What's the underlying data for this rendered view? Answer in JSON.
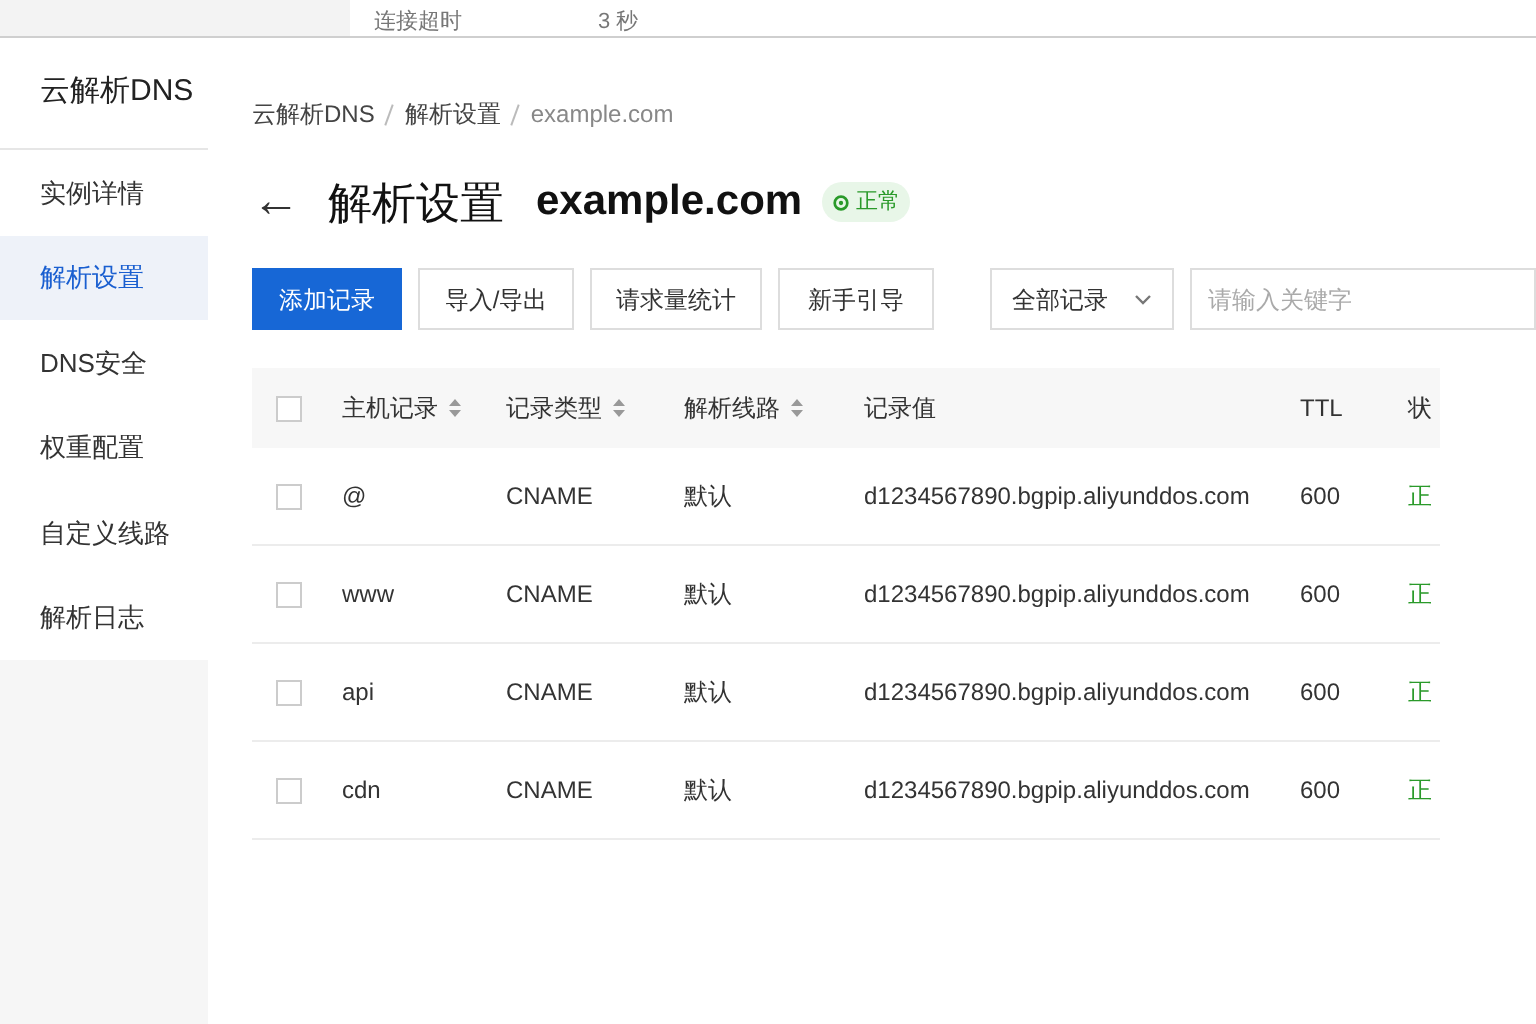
{
  "top_strip": {
    "label": "连接超时",
    "value": "3 秒"
  },
  "sidebar": {
    "title": "云解析DNS",
    "items": [
      {
        "label": "实例详情",
        "selected": false
      },
      {
        "label": "解析设置",
        "selected": true
      },
      {
        "label": "DNS安全",
        "selected": false
      },
      {
        "label": "权重配置",
        "selected": false
      },
      {
        "label": "自定义线路",
        "selected": false
      },
      {
        "label": "解析日志",
        "selected": false
      }
    ]
  },
  "breadcrumb": [
    "云解析DNS",
    "解析设置",
    "example.com"
  ],
  "page_title": {
    "back": "←",
    "title": "解析设置",
    "domain": "example.com",
    "status": "正常"
  },
  "toolbar": {
    "buttons": [
      {
        "label": "添加记录",
        "kind": "primary"
      },
      {
        "label": "导入/导出",
        "kind": "default"
      },
      {
        "label": "请求量统计",
        "kind": "default"
      },
      {
        "label": "新手引导",
        "kind": "default"
      }
    ],
    "filter": "全部记录",
    "search": {
      "placeholder": "请输入关键字"
    }
  },
  "table": {
    "select_all": {
      "checked": false
    },
    "columns": [
      {
        "label": "主机记录",
        "sortable": true
      },
      {
        "label": "记录类型",
        "sortable": true
      },
      {
        "label": "解析线路",
        "sortable": true
      },
      {
        "label": "记录值",
        "sortable": false
      },
      {
        "label": "TTL",
        "sortable": false
      },
      {
        "label": "状",
        "sortable": false
      }
    ],
    "rows": [
      {
        "checked": false,
        "cells": [
          "@",
          "CNAME",
          "默认",
          "d1234567890.bgpip.aliyunddos.com",
          "600",
          "正"
        ]
      },
      {
        "checked": false,
        "cells": [
          "www",
          "CNAME",
          "默认",
          "d1234567890.bgpip.aliyunddos.com",
          "600",
          "正"
        ]
      },
      {
        "checked": false,
        "cells": [
          "api",
          "CNAME",
          "默认",
          "d1234567890.bgpip.aliyunddos.com",
          "600",
          "正"
        ]
      },
      {
        "checked": false,
        "cells": [
          "cdn",
          "CNAME",
          "默认",
          "d1234567890.bgpip.aliyunddos.com",
          "600",
          "正"
        ]
      }
    ]
  }
}
